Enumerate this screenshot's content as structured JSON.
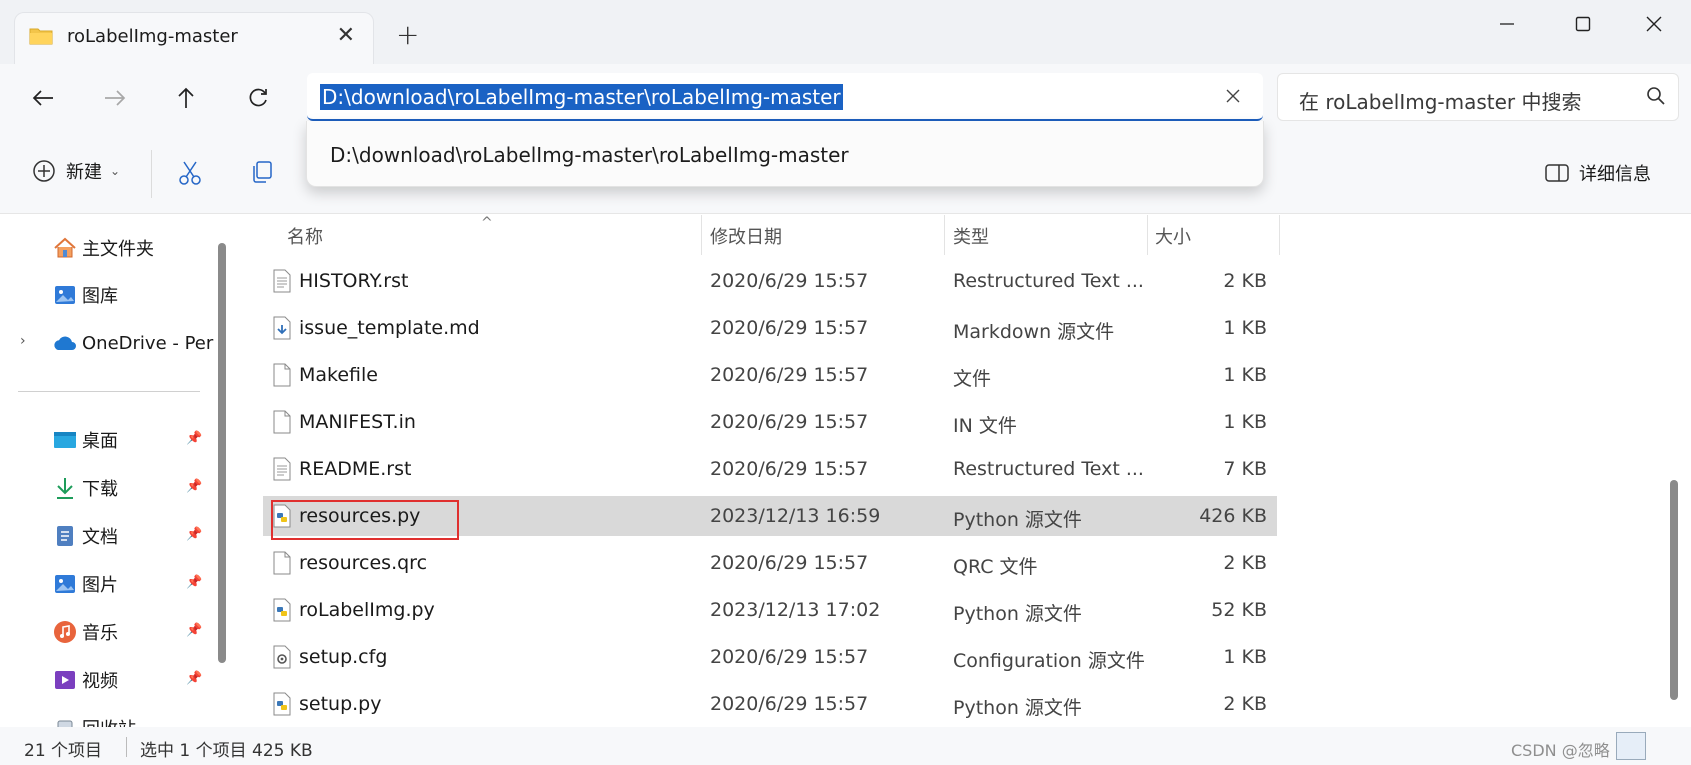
{
  "window": {
    "tab_title": "roLabelImg-master",
    "new_tab": "+",
    "minimize": "—",
    "maximize": "☐",
    "close": "✕"
  },
  "nav": {
    "back": "←",
    "forward": "→",
    "up": "↑",
    "refresh": "↻",
    "address": "D:\\download\\roLabelImg-master\\roLabelImg-master",
    "clear": "✕",
    "search_placeholder": "在 roLabelImg-master 中搜索"
  },
  "dropdown": {
    "suggestion": "D:\\download\\roLabelImg-master\\roLabelImg-master"
  },
  "commandbar": {
    "new_label": "新建",
    "new_chevron": "⌄",
    "details_label": "详细信息"
  },
  "sidebar": {
    "items": [
      {
        "label": "主文件夹",
        "icon": "home-icon"
      },
      {
        "label": "图库",
        "icon": "gallery-icon"
      },
      {
        "label": "OneDrive - Per",
        "icon": "onedrive-icon",
        "expander": "›"
      },
      {
        "label": "桌面",
        "icon": "desktop-icon",
        "pinned": true
      },
      {
        "label": "下载",
        "icon": "download-icon",
        "pinned": true
      },
      {
        "label": "文档",
        "icon": "documents-icon",
        "pinned": true
      },
      {
        "label": "图片",
        "icon": "pictures-icon",
        "pinned": true
      },
      {
        "label": "音乐",
        "icon": "music-icon",
        "pinned": true
      },
      {
        "label": "视频",
        "icon": "videos-icon",
        "pinned": true
      },
      {
        "label": "回收站",
        "icon": "recycle-bin-icon",
        "pinned": true
      }
    ]
  },
  "columns": {
    "name": "名称",
    "modified": "修改日期",
    "type": "类型",
    "size": "大小",
    "sort_indicator": "^"
  },
  "files": [
    {
      "name": "HISTORY.rst",
      "modified": "2020/6/29 15:57",
      "type": "Restructured Text ...",
      "size": "2 KB",
      "icon": "text-file-icon"
    },
    {
      "name": "issue_template.md",
      "modified": "2020/6/29 15:57",
      "type": "Markdown 源文件",
      "size": "1 KB",
      "icon": "markdown-file-icon"
    },
    {
      "name": "Makefile",
      "modified": "2020/6/29 15:57",
      "type": "文件",
      "size": "1 KB",
      "icon": "blank-file-icon"
    },
    {
      "name": "MANIFEST.in",
      "modified": "2020/6/29 15:57",
      "type": "IN 文件",
      "size": "1 KB",
      "icon": "blank-file-icon"
    },
    {
      "name": "README.rst",
      "modified": "2020/6/29 15:57",
      "type": "Restructured Text ...",
      "size": "7 KB",
      "icon": "text-file-icon"
    },
    {
      "name": "resources.py",
      "modified": "2023/12/13 16:59",
      "type": "Python 源文件",
      "size": "426 KB",
      "icon": "python-file-icon",
      "selected": true
    },
    {
      "name": "resources.qrc",
      "modified": "2020/6/29 15:57",
      "type": "QRC 文件",
      "size": "2 KB",
      "icon": "blank-file-icon"
    },
    {
      "name": "roLabelImg.py",
      "modified": "2023/12/13 17:02",
      "type": "Python 源文件",
      "size": "52 KB",
      "icon": "python-file-icon"
    },
    {
      "name": "setup.cfg",
      "modified": "2020/6/29 15:57",
      "type": "Configuration 源文件",
      "size": "1 KB",
      "icon": "config-file-icon"
    },
    {
      "name": "setup.py",
      "modified": "2020/6/29 15:57",
      "type": "Python 源文件",
      "size": "2 KB",
      "icon": "python-file-icon"
    }
  ],
  "status": {
    "count": "21 个项目",
    "selection": "选中 1 个项目  425 KB",
    "watermark": "CSDN @忽略"
  },
  "colors": {
    "accent": "#1a62c4",
    "selection_bg": "#d9d9d9",
    "highlight_box": "#e0302f",
    "python_blue": "#3b78b8"
  }
}
